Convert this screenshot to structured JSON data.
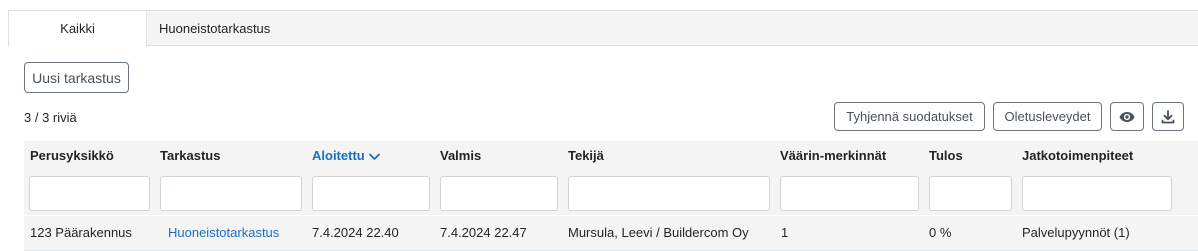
{
  "tabs": [
    {
      "label": "Kaikki"
    },
    {
      "label": "Huoneistotarkastus"
    }
  ],
  "toolbar": {
    "new_inspection_label": "Uusi tarkastus",
    "row_count": "3 / 3 riviä",
    "clear_filters_label": "Tyhjennä suodatukset",
    "default_widths_label": "Oletusleveydet",
    "visibility_icon": "eye-icon",
    "download_icon": "download-icon"
  },
  "table": {
    "columns": [
      {
        "label": "Perusyksikkö"
      },
      {
        "label": "Tarkastus"
      },
      {
        "label": "Aloitettu",
        "sorted": "desc"
      },
      {
        "label": "Valmis"
      },
      {
        "label": "Tekijä"
      },
      {
        "label": "Väärin-merkinnät"
      },
      {
        "label": "Tulos"
      },
      {
        "label": "Jatkotoimenpiteet"
      }
    ],
    "rows": [
      [
        "123 Päärakennus",
        "Huoneistotarkastus",
        "7.4.2024 22.40",
        "7.4.2024 22.47",
        "Mursula, Leevi / Buildercom Oy",
        "1",
        "0 %",
        "Palvelupyynnöt (1)"
      ]
    ]
  },
  "colors": {
    "link": "#1b6ec2",
    "header_bg": "#f4f4f4",
    "border": "#dee2e6"
  }
}
